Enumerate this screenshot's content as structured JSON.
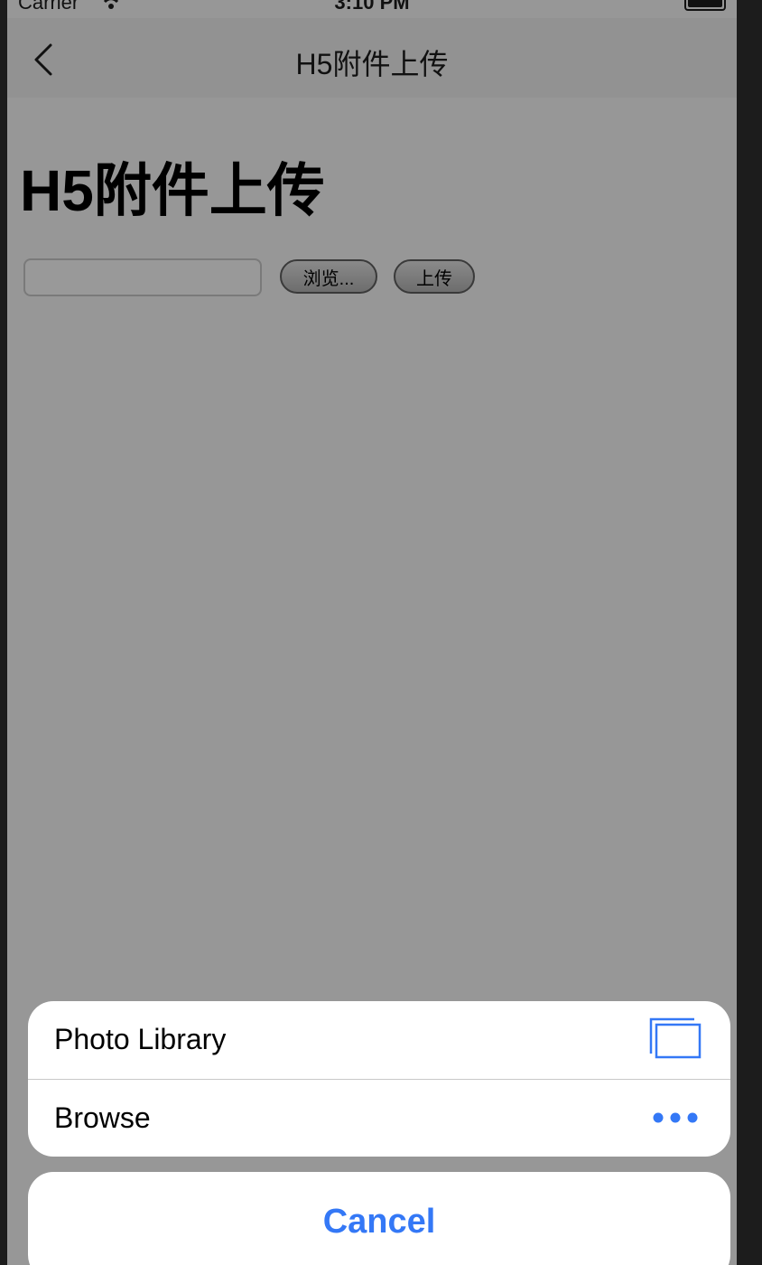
{
  "status_bar": {
    "carrier": "Carrier",
    "time": "3:10 PM"
  },
  "nav_bar": {
    "title": "H5附件上传",
    "back_icon": "chevron-left-icon"
  },
  "page": {
    "heading": "H5附件上传",
    "file_input_value": "",
    "browse_label": "浏览...",
    "upload_label": "上传"
  },
  "action_sheet": {
    "options": [
      {
        "label": "Photo Library",
        "icon": "photo-library-icon"
      },
      {
        "label": "Browse",
        "icon": "more-dots-icon"
      }
    ],
    "cancel_label": "Cancel",
    "accent_color": "#3478f6"
  }
}
